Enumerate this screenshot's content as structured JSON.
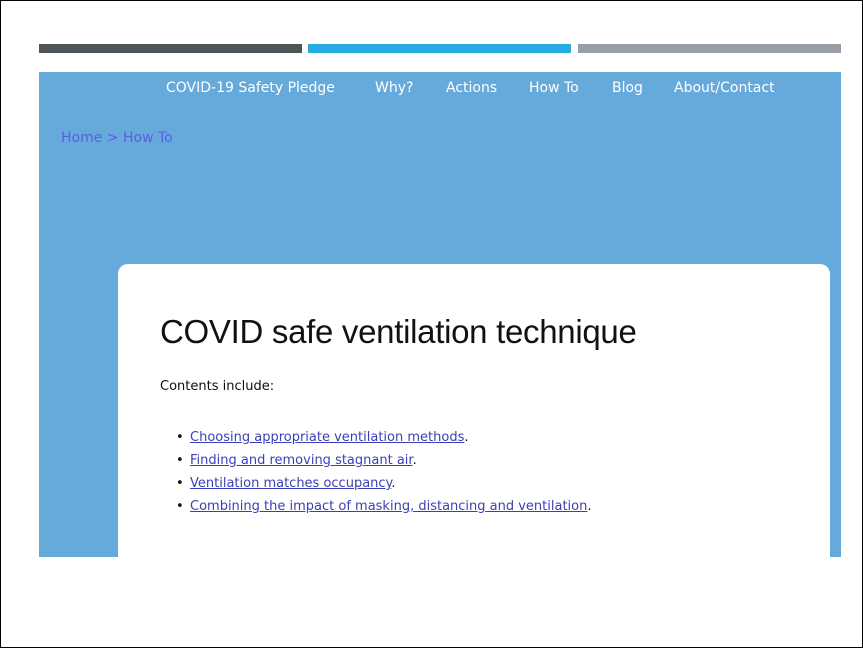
{
  "colors": {
    "stripe_1": "#4d5558",
    "stripe_2": "#27ace2",
    "stripe_3": "#979ea5",
    "header_bg": "#66aadc",
    "nav_text": "#ffffff",
    "breadcrumb_link": "#5b5fe3",
    "link": "#3b3fb5",
    "title_text": "#111111",
    "body_text": "#111111"
  },
  "nav": {
    "items": [
      {
        "label": "COVID-19 Safety Pledge"
      },
      {
        "label": "Why?"
      },
      {
        "label": "Actions"
      },
      {
        "label": "How To"
      },
      {
        "label": "Blog"
      },
      {
        "label": "About/Contact"
      }
    ]
  },
  "breadcrumb": {
    "home": "Home",
    "separator": ">",
    "current": "How To"
  },
  "main": {
    "title": "COVID safe ventilation technique",
    "intro": "Contents include:",
    "bullet_glyph": "•",
    "contents": [
      {
        "label": "Choosing appropriate ventilation methods",
        "suffix": "."
      },
      {
        "label": "Finding and removing stagnant air",
        "suffix": "."
      },
      {
        "label": "Ventilation matches occupancy",
        "suffix": "."
      },
      {
        "label": "Combining the impact of masking, distancing and ventilation",
        "suffix": "."
      }
    ]
  }
}
